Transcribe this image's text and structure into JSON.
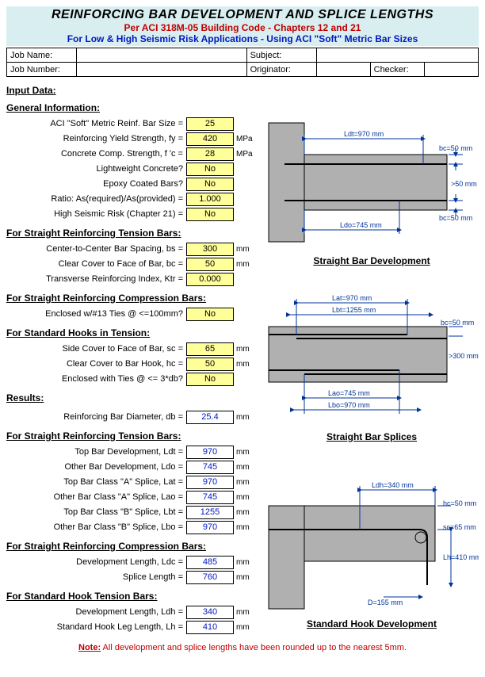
{
  "header": {
    "title": "REINFORCING BAR DEVELOPMENT AND SPLICE LENGTHS",
    "sub1": "Per ACI 318M-05 Building Code - Chapters 12 and 21",
    "sub2": "For Low & High Seismic Risk Applications - Using ACI \"Soft\" Metric Bar Sizes"
  },
  "job": {
    "name_label": "Job Name:",
    "name_val": "",
    "subject_label": "Subject:",
    "subject_val": "",
    "number_label": "Job Number:",
    "number_val": "",
    "originator_label": "Originator:",
    "originator_val": "",
    "checker_label": "Checker:",
    "checker_val": ""
  },
  "sections": {
    "input_data": "Input Data:",
    "general_info": "General Information:",
    "tension_bars": "For Straight Reinforcing Tension Bars:",
    "comp_bars": "For Straight Reinforcing Compression Bars:",
    "hooks": "For Standard Hooks in Tension:",
    "results": "Results:",
    "tension_bars2": "For Straight Reinforcing Tension Bars:",
    "comp_bars2": "For Straight Reinforcing Compression Bars:",
    "hook_bars": "For Standard Hook Tension Bars:"
  },
  "inputs": {
    "bar_size": {
      "label": "ACI \"Soft\" Metric Reinf. Bar Size =",
      "val": "25",
      "unit": ""
    },
    "fy": {
      "label": "Reinforcing Yield Strength, fy =",
      "val": "420",
      "unit": "MPa"
    },
    "fc": {
      "label": "Concrete Comp. Strength, f 'c =",
      "val": "28",
      "unit": "MPa"
    },
    "lw": {
      "label": "Lightweight Concrete?",
      "val": "No",
      "unit": ""
    },
    "epoxy": {
      "label": "Epoxy Coated Bars?",
      "val": "No",
      "unit": ""
    },
    "ratio": {
      "label": "Ratio: As(required)/As(provided) =",
      "val": "1.000",
      "unit": ""
    },
    "seismic": {
      "label": "High Seismic Risk (Chapter 21) =",
      "val": "No",
      "unit": ""
    },
    "bs": {
      "label": "Center-to-Center Bar Spacing, bs =",
      "val": "300",
      "unit": "mm"
    },
    "bc": {
      "label": "Clear Cover to Face of Bar, bc =",
      "val": "50",
      "unit": "mm"
    },
    "ktr": {
      "label": "Transverse Reinforcing Index, Ktr =",
      "val": "0.000",
      "unit": ""
    },
    "enclosed13": {
      "label": "Enclosed w/#13 Ties @ <=100mm?",
      "val": "No",
      "unit": ""
    },
    "sc": {
      "label": "Side Cover to Face of Bar, sc =",
      "val": "65",
      "unit": "mm"
    },
    "hc": {
      "label": "Clear Cover to Bar Hook, hc =",
      "val": "50",
      "unit": "mm"
    },
    "encl3db": {
      "label": "Enclosed with Ties @ <= 3*db?",
      "val": "No",
      "unit": ""
    }
  },
  "outputs": {
    "db": {
      "label": "Reinforcing Bar Diameter, db =",
      "val": "25.4",
      "unit": "mm"
    },
    "ldt": {
      "label": "Top Bar Development, Ldt =",
      "val": "970",
      "unit": "mm"
    },
    "ldo": {
      "label": "Other Bar Development, Ldo =",
      "val": "745",
      "unit": "mm"
    },
    "lat": {
      "label": "Top Bar Class \"A\" Splice, Lat =",
      "val": "970",
      "unit": "mm"
    },
    "lao": {
      "label": "Other Bar Class \"A\" Splice, Lao =",
      "val": "745",
      "unit": "mm"
    },
    "lbt": {
      "label": "Top Bar Class \"B\" Splice, Lbt =",
      "val": "1255",
      "unit": "mm"
    },
    "lbo": {
      "label": "Other Bar Class \"B\" Splice, Lbo =",
      "val": "970",
      "unit": "mm"
    },
    "ldc": {
      "label": "Development Length, Ldc =",
      "val": "485",
      "unit": "mm"
    },
    "splice": {
      "label": "Splice Length =",
      "val": "760",
      "unit": "mm"
    },
    "ldh": {
      "label": "Development Length, Ldh =",
      "val": "340",
      "unit": "mm"
    },
    "lh": {
      "label": "Standard Hook Leg Length, Lh =",
      "val": "410",
      "unit": "mm"
    }
  },
  "diagrams": {
    "d1_caption": "Straight Bar Development",
    "d1": {
      "ldt": "Ldt=970 mm",
      "bc_top": "bc=50 mm",
      "gt50": ">50 mm",
      "ldo": "Ldo=745 mm",
      "bc_bot": "bc=50 mm"
    },
    "d2_caption": "Straight Bar Splices",
    "d2": {
      "lat": "Lat=970 mm",
      "lbt": "Lbt=1255 mm",
      "bc": "bc=50 mm",
      "gt300": ">300 mm",
      "lao": "Lao=745 mm",
      "lbo": "Lbo=970 mm"
    },
    "d3_caption": "Standard Hook Development",
    "d3": {
      "ldh": "Ldh=340 mm",
      "hc": "hc=50 mm",
      "sc": "sc=65 mm",
      "lh": "Lh=410 mm",
      "d": "D=155 mm"
    }
  },
  "note": {
    "label": "Note:",
    "text": " All development and splice lengths have been rounded up to the nearest 5mm."
  }
}
